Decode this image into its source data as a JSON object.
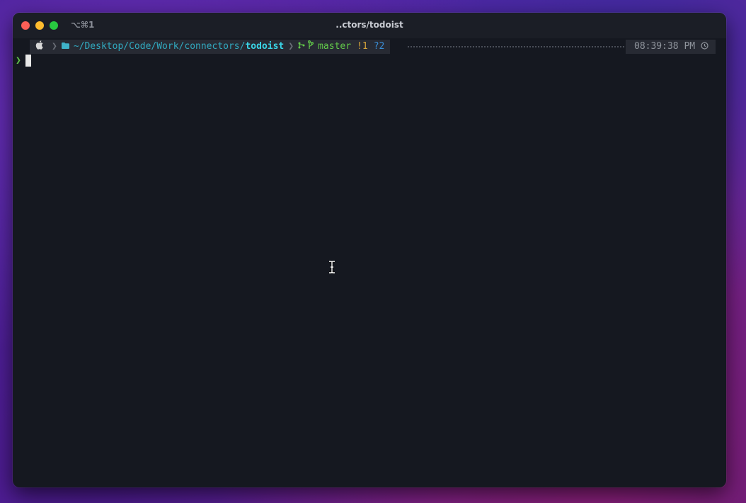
{
  "window": {
    "title": "..ctors/todoist",
    "tab_shortcut": "⌥⌘1"
  },
  "prompt": {
    "os_icon": "apple-icon",
    "folder_icon": "folder-icon",
    "path_prefix": "~/Desktop/Code/Work/connectors/",
    "path_current": "todoist",
    "git_icon": "git-icon",
    "branch_icon": "branch-icon",
    "branch": "master",
    "modified": "!1",
    "untracked": "?2",
    "time": "08:39:38 PM",
    "clock_icon": "clock-icon"
  },
  "input": {
    "prompt_symbol": "❯",
    "command": ""
  },
  "colors": {
    "background": "#151820",
    "path": "#31a9bf",
    "branch": "#62c94a",
    "modified": "#d6a43a",
    "untracked": "#3a8ed6"
  }
}
